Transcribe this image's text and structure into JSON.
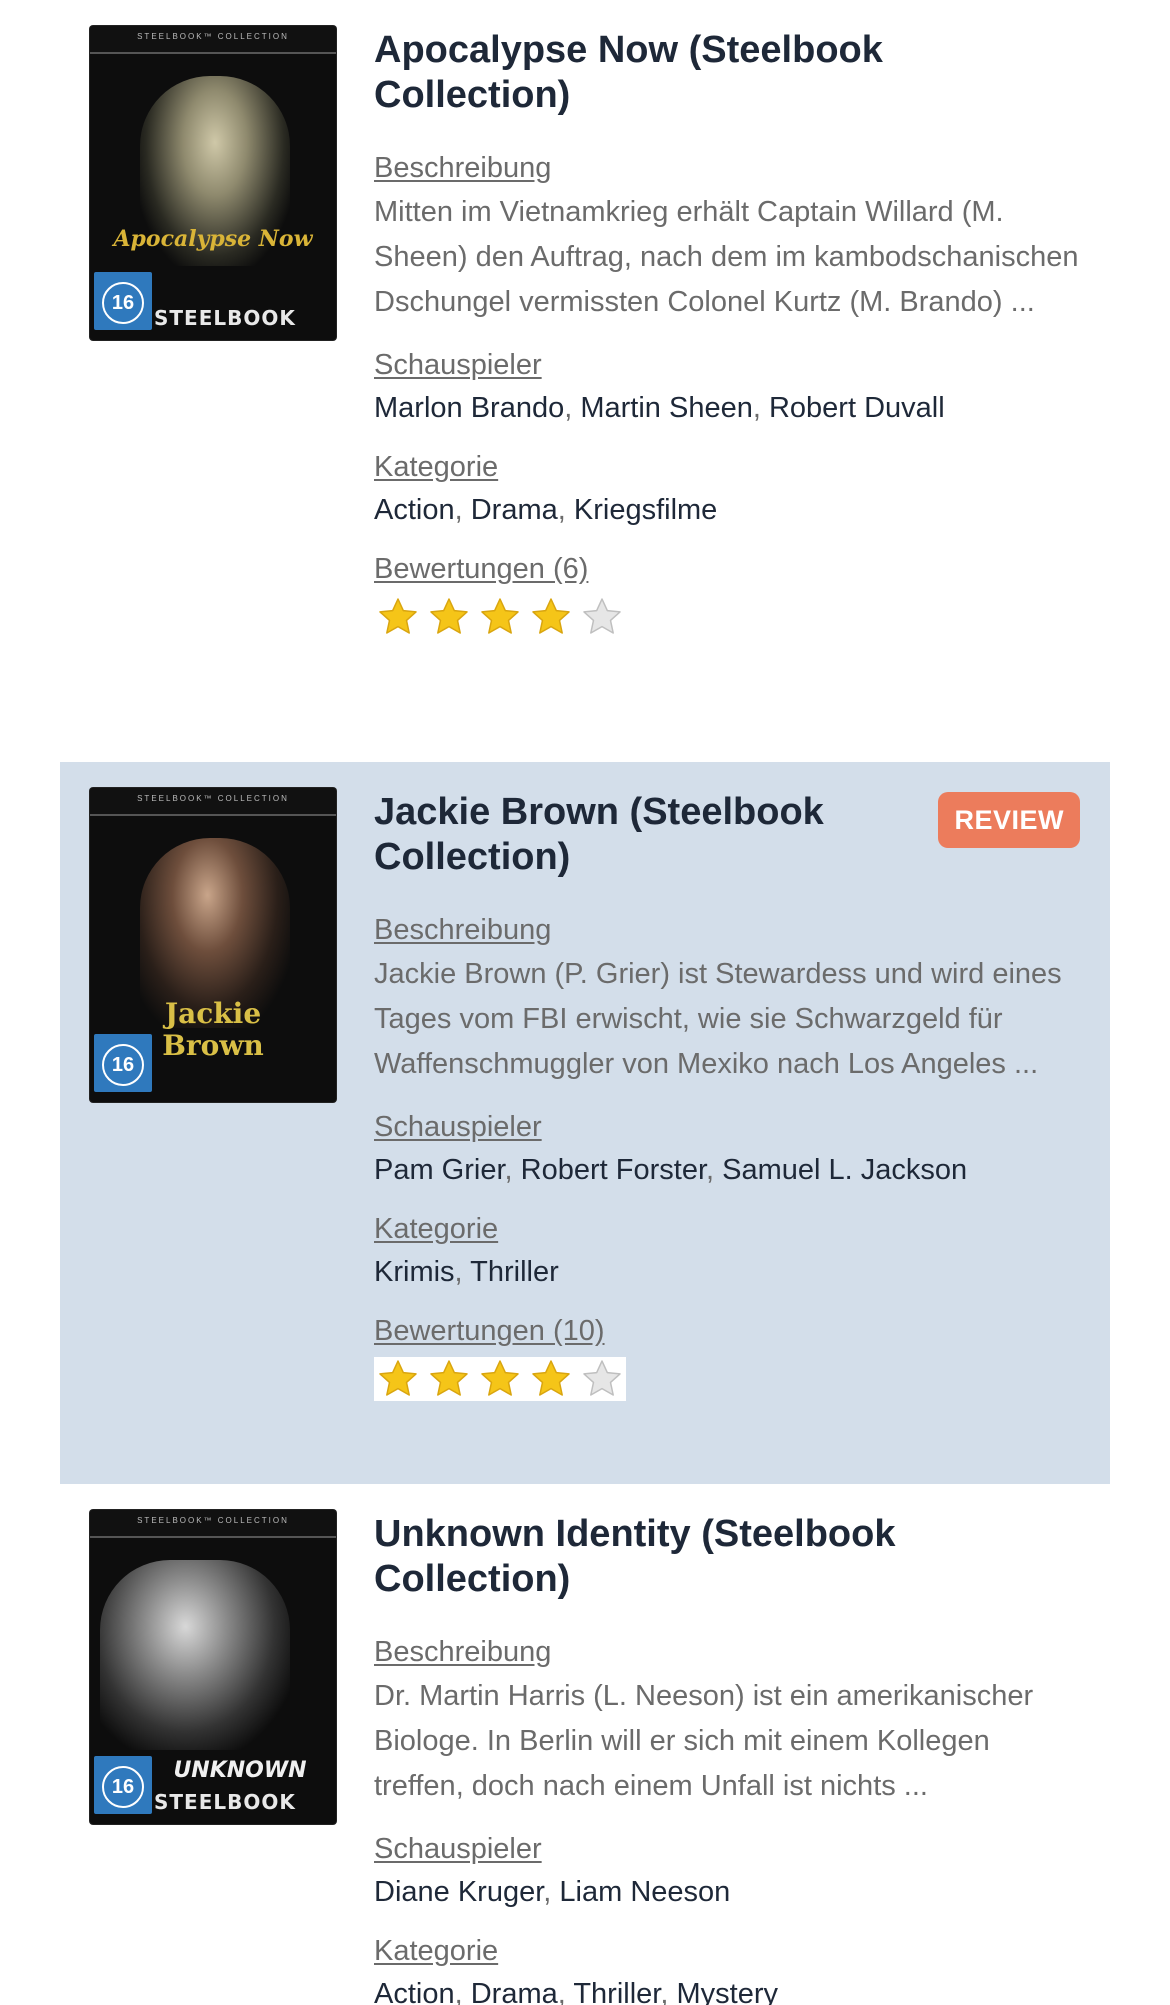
{
  "section_labels": {
    "description": "Beschreibung",
    "actors": "Schauspieler",
    "category": "Kategorie"
  },
  "colors": {
    "highlight_background": "#d3deea",
    "review_badge": "#ec7c5c",
    "star_filled": "#f5c518",
    "star_empty": "#e6e6e6"
  },
  "movies": [
    {
      "title": "Apocalypse Now (Steelbook Collection)",
      "cover": {
        "band_text": "STEELBOOK™ COLLECTION",
        "fsk": "16",
        "edition": "STEELBOOK",
        "title_text": "Apocalypse Now"
      },
      "description": "Mitten im Vietnamkrieg erhält Captain Willard (M. Sheen) den Auftrag, nach dem im kambodschanischen Dschungel vermissten Colonel Kurtz (M. Brando) ...",
      "actors": [
        "Marlon Brando",
        "Martin Sheen",
        "Robert Duvall"
      ],
      "categories": [
        "Action",
        "Drama",
        "Kriegsfilme"
      ],
      "ratings_label": "Bewertungen (6)",
      "rating": 4,
      "rating_max": 5,
      "review_badge": null
    },
    {
      "title": "Jackie Brown (Steelbook Collection)",
      "cover": {
        "band_text": "STEELBOOK™ COLLECTION",
        "fsk": "16",
        "edition": "",
        "title_text": "Jackie Brown"
      },
      "description": "Jackie Brown (P. Grier) ist Stewardess und wird eines Tages vom FBI erwischt, wie sie Schwarzgeld für Waffenschmuggler von Mexiko nach Los Angeles ...",
      "actors": [
        "Pam Grier",
        "Robert Forster",
        "Samuel L. Jackson"
      ],
      "categories": [
        "Krimis",
        "Thriller"
      ],
      "ratings_label": "Bewertungen (10)",
      "rating": 4,
      "rating_max": 5,
      "review_badge": "REVIEW"
    },
    {
      "title": "Unknown Identity (Steelbook Collection)",
      "cover": {
        "band_text": "STEELBOOK™ COLLECTION",
        "fsk": "16",
        "edition": "STEELBOOK",
        "title_text": "UNKNOWN"
      },
      "description": "Dr. Martin Harris (L. Neeson) ist ein amerikanischer Biologe. In Berlin will er sich mit einem Kollegen treffen, doch nach einem Unfall ist nichts ...",
      "actors": [
        "Diane Kruger",
        "Liam Neeson"
      ],
      "categories": [
        "Action",
        "Drama",
        "Thriller",
        "Mystery"
      ],
      "ratings_label": "",
      "rating": null,
      "rating_max": 5,
      "review_badge": null
    }
  ]
}
